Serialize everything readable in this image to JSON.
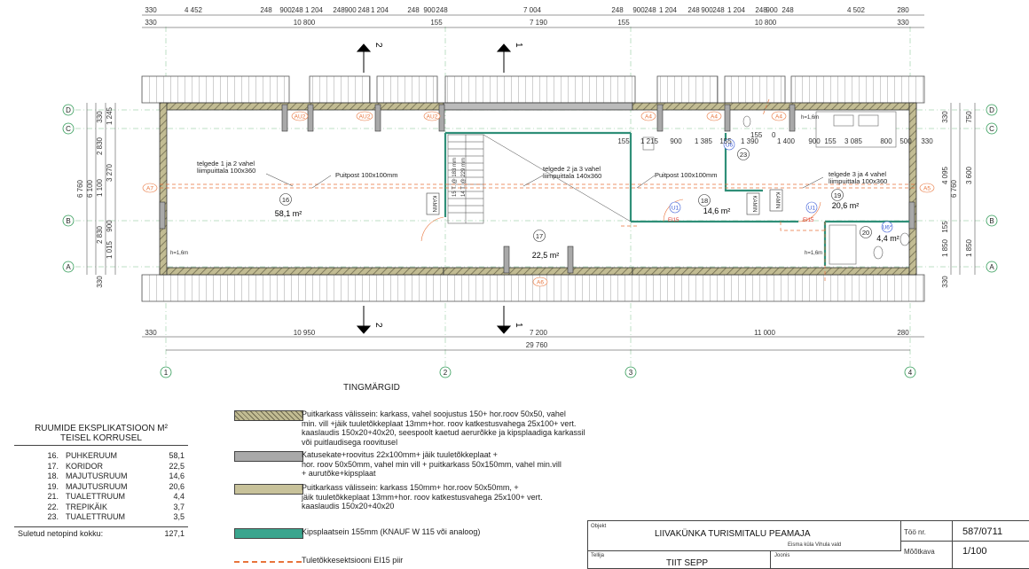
{
  "top_dims_row1": [
    "330",
    "4 452",
    "248",
    "900",
    "248",
    "1 204",
    "248",
    "900",
    "248",
    "1 204",
    "248",
    "900",
    "248",
    "7 004",
    "248",
    "900",
    "248",
    "1 204",
    "248",
    "900",
    "248",
    "1 204",
    "248",
    "900",
    "248",
    "4 502",
    "280"
  ],
  "top_dims_row2": [
    "330",
    "10 800",
    "155",
    "7 190",
    "155",
    "10 800",
    "330"
  ],
  "bottom_dims_row1": [
    "330",
    "10 950",
    "7 200",
    "11 000",
    "280"
  ],
  "bottom_total": "29 760",
  "inner_dims_right": [
    "155",
    "1 215",
    "900",
    "1 385",
    "155",
    "1 390",
    "1 400",
    "900",
    "155",
    "3 085",
    "800",
    "500",
    "330"
  ],
  "inner_dims_mid": [
    "155",
    "0"
  ],
  "left_dims_outer": "6 760",
  "left_dims_mid": "6 100",
  "left_dims_inner": [
    "330",
    "2 830",
    "1 100",
    "2 830",
    "330"
  ],
  "left_dims_far": [
    "1 245",
    "3 270",
    "900",
    "1 015"
  ],
  "right_dims_inner": [
    "330",
    "4 095",
    "155",
    "1 850",
    "330"
  ],
  "right_dims_mid": "6 760",
  "right_dims_outer": [
    "750",
    "3 600",
    "1 850"
  ],
  "axes_letters": [
    "D",
    "C",
    "B",
    "A"
  ],
  "axes_numbers": [
    "1",
    "2",
    "3",
    "4"
  ],
  "section_marks": [
    "2",
    "1"
  ],
  "rooms": [
    {
      "no": "16",
      "area": "58,1 m²"
    },
    {
      "no": "17",
      "area": "22,5 m²"
    },
    {
      "no": "18",
      "area": "14,6 m²"
    },
    {
      "no": "19",
      "area": "20,6 m²"
    },
    {
      "no": "20",
      "area": "4,4 m²"
    },
    {
      "no": "23",
      "area": ""
    }
  ],
  "annotations": {
    "beam_1_2": "telgede  1 ja 2 vahel\nliimpuittala 100x360",
    "beam_2_3": "telgede  2 ja 3 vahel\nliimpuittala 140x360",
    "beam_3_4": "telgede  3 ja 4 vahel\nliimpuittala 100x360",
    "post_1": "Puitpost 100x100mm",
    "post_2": "Puitpost 100x100mm",
    "stairs_1": "15 T. @ 183 mm",
    "stairs_2": "14 T. @ 229 mm",
    "kamin": "KAMIN",
    "h_note": "h=1,6m"
  },
  "window_tags": [
    "AU2",
    "AU2",
    "AU2",
    "A4",
    "A4",
    "A4",
    "A7",
    "A5",
    "A6"
  ],
  "door_tags": [
    "U1",
    "U1",
    "U6",
    "U6*"
  ],
  "fire_tags": [
    "EI15",
    "EI15"
  ],
  "legend_title": "TINGMÄRGID",
  "legend": [
    {
      "swatch": "#b9b38a",
      "text": "Puitkarkass välissein: karkass, vahel soojustus 150+ hor.roov 50x50, vahel\nmin. vill +jäik tuuletõkkeplaat 13mm+hor. roov katkestusvahega 25x100+ vert.\nkaaslaudis 150x20+40x20, seespoolt kaetud aerurõkke ja kipsplaadiga karkassil\nvõi puitlaudisega roovitusel"
    },
    {
      "swatch": "#a9a9a9",
      "text": "Katusekate+roovitus 22x100mm+ jäik tuuletõkkeplaat +\n hor. roov 50x50mm, vahel min vill +  puitkarkass 50x150mm, vahel min.vill\n + aurutõke+kipsplaat"
    },
    {
      "swatch": "#c8c29a",
      "text": "Puitkarkass välissein: karkass 150mm+ hor.roov 50x50mm,  +\njäik tuuletõkkeplaat 13mm+hor. roov katkestusvahega 25x100+ vert.\nkaaslaudis 150x20+40x20"
    },
    {
      "swatch": "#3aa58e",
      "text": "Kipsplaatsein 155mm (KNAUF W 115 või analoog)"
    },
    {
      "swatch": "#e8743b",
      "text": "Tuletõkkesektsiooni EI15 piir"
    }
  ],
  "explication": {
    "title": "RUUMIDE EKSPLIKATSIOON M²\nTEISEL KORRUSEL",
    "rows": [
      {
        "no": "16.",
        "name": "PUHKERUUM",
        "area": "58,1"
      },
      {
        "no": "17.",
        "name": "KORIDOR",
        "area": "22,5"
      },
      {
        "no": "18.",
        "name": "MAJUTUSRUUM",
        "area": "14,6"
      },
      {
        "no": "19.",
        "name": "MAJUTUSRUUM",
        "area": "20,6"
      },
      {
        "no": "21.",
        "name": "TUALETTRUUM",
        "area": "4,4"
      },
      {
        "no": "22.",
        "name": "TREPIKÄIK",
        "area": "3,7"
      },
      {
        "no": "23.",
        "name": "TUALETTRUUM",
        "area": "3,5"
      }
    ],
    "total_label": "Suletud netopind kokku:",
    "total_value": "127,1"
  },
  "title_block": {
    "objekt_label": "Objekt",
    "objekt": "LIIVAKÜNKA TURISMITALU PEAMAJA",
    "location": "Eisma küla Vihula vald",
    "tellija_label": "Tellija",
    "tellija": "TIIT SEPP",
    "joonis_label": "Joonis",
    "too_label": "Töö nr.",
    "too_value": "587/0711",
    "mootkava_label": "Mõõtkava",
    "mootkava_value": "1/100"
  }
}
